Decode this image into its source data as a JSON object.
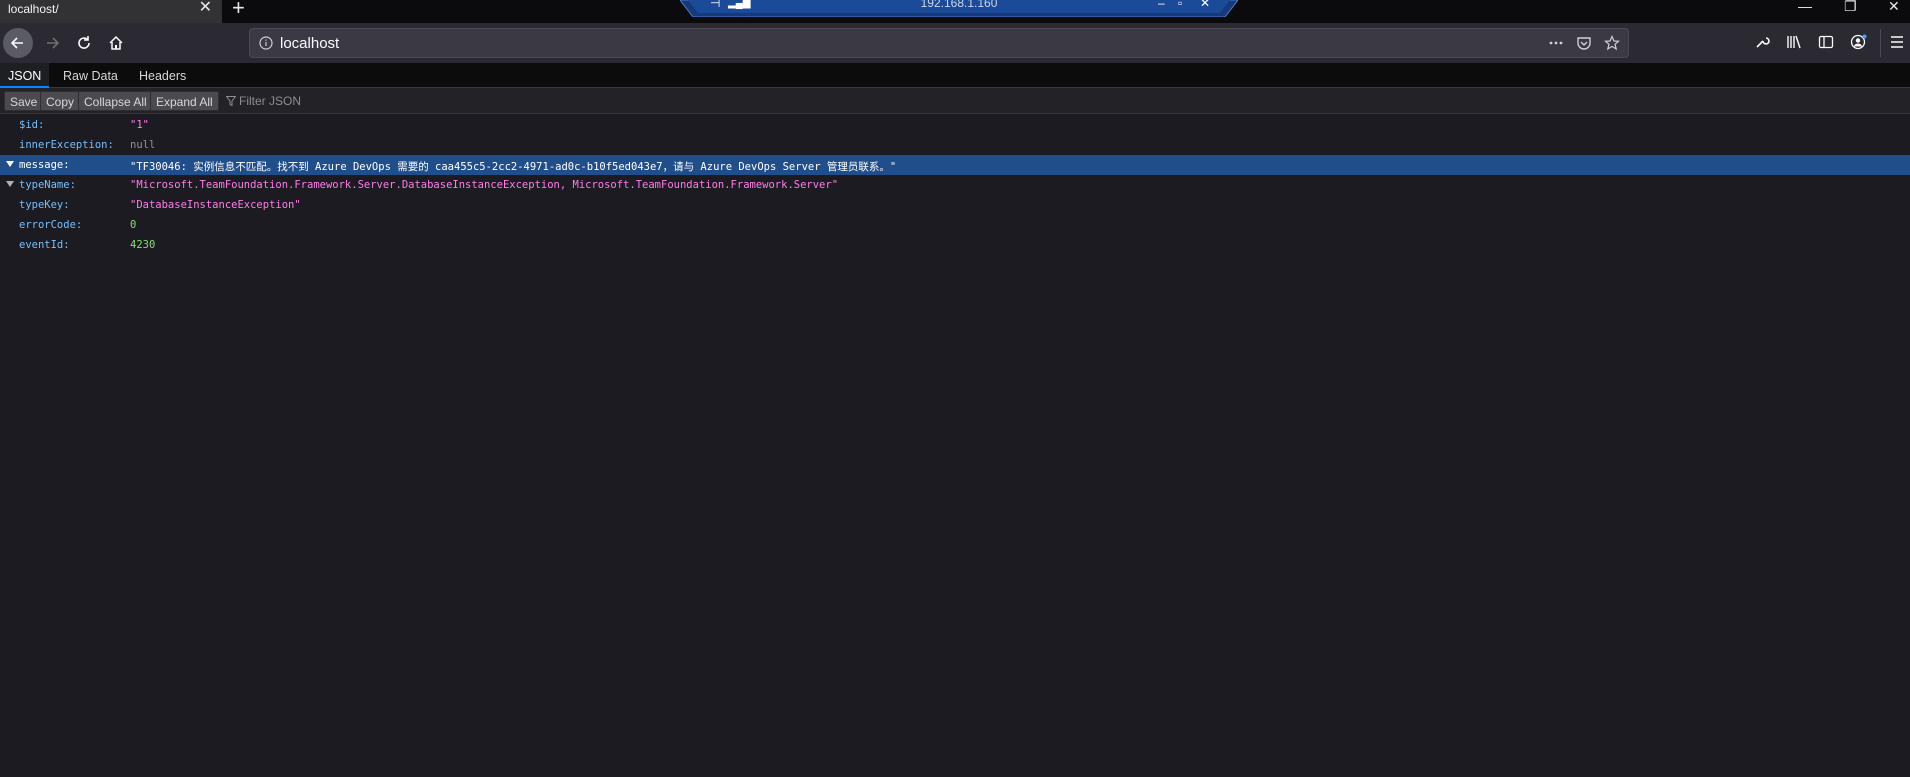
{
  "tab": {
    "title": "localhost/"
  },
  "remote_banner": {
    "ip": "192.168.1.160"
  },
  "navbar": {
    "url": "localhost"
  },
  "viewer": {
    "tabs": [
      "JSON",
      "Raw Data",
      "Headers"
    ],
    "toolbar": {
      "save": "Save",
      "copy": "Copy",
      "collapse_all": "Collapse All",
      "expand_all": "Expand All",
      "filter_placeholder": "Filter JSON"
    },
    "rows": [
      {
        "key": "$id:",
        "value": "\"1\"",
        "type": "str"
      },
      {
        "key": "innerException:",
        "value": "null",
        "type": "null"
      },
      {
        "key": "message:",
        "value": "\"TF30046: 实例信息不匹配。找不到 Azure DevOps 需要的 caa455c5-2cc2-4971-ad0c-b10f5ed043e7，请与 Azure DevOps Server 管理员联系。\"",
        "type": "str"
      },
      {
        "key": "typeName:",
        "value": "\"Microsoft.TeamFoundation.Framework.Server.DatabaseInstanceException, Microsoft.TeamFoundation.Framework.Server\"",
        "type": "str"
      },
      {
        "key": "typeKey:",
        "value": "\"DatabaseInstanceException\"",
        "type": "str"
      },
      {
        "key": "errorCode:",
        "value": "0",
        "type": "num"
      },
      {
        "key": "eventId:",
        "value": "4230",
        "type": "num"
      }
    ]
  },
  "colors": {
    "background": "#1c1b22",
    "key": "#75bfff",
    "string": "#ff7de9",
    "number": "#86de74",
    "selection": "#204e8a"
  }
}
